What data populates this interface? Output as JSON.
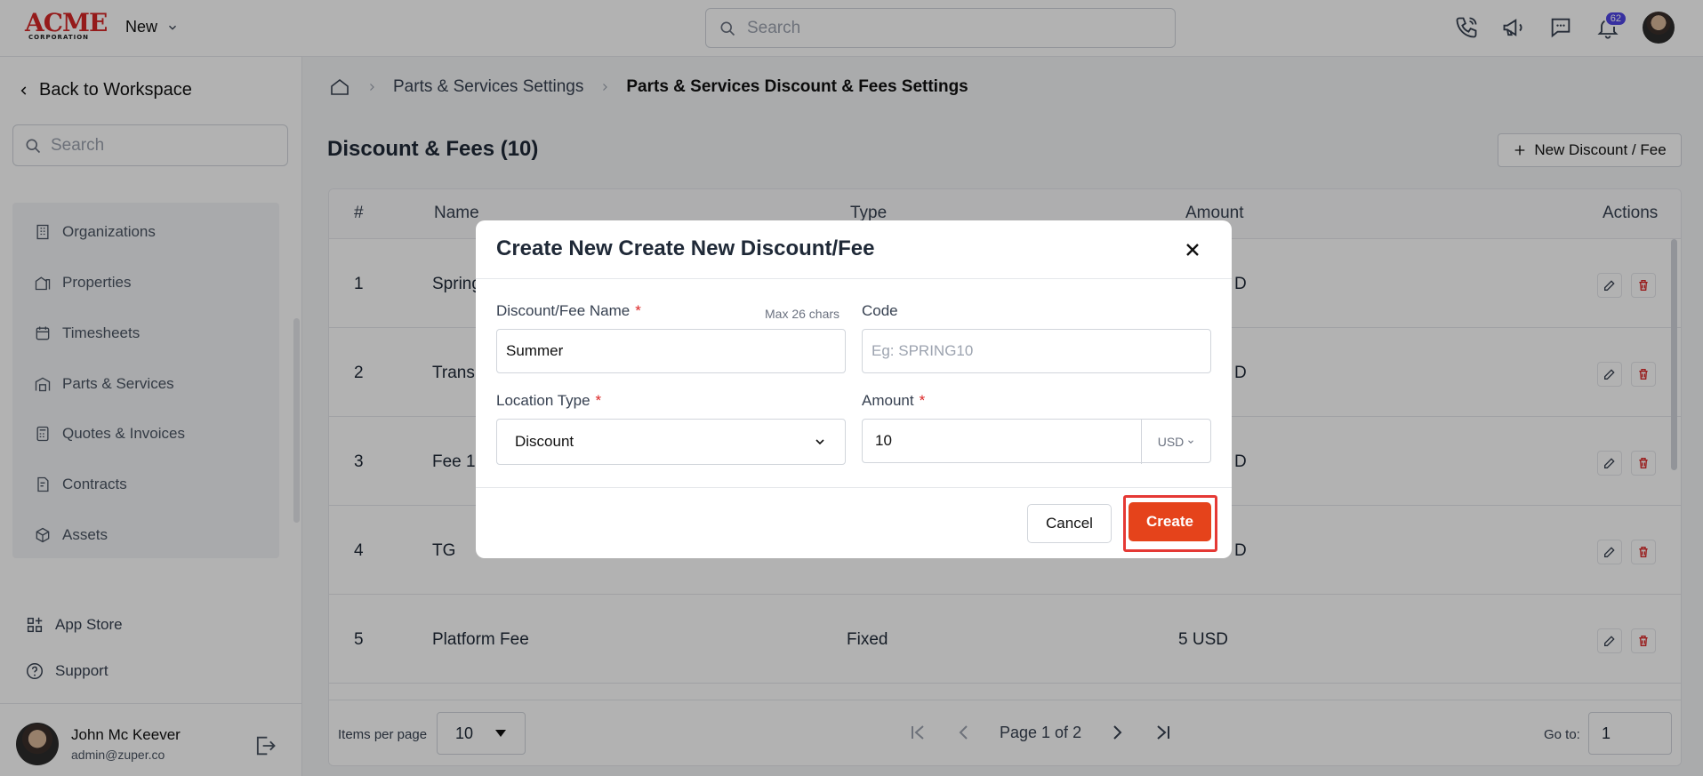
{
  "topbar": {
    "logo_text": "ACME",
    "logo_subtext": "CORPORATION",
    "new_label": "New",
    "search_placeholder": "Search",
    "notification_count": "62"
  },
  "sidebar": {
    "back_label": "Back to Workspace",
    "search_placeholder": "Search",
    "items": [
      {
        "label": "Organizations",
        "icon": "building-icon"
      },
      {
        "label": "Properties",
        "icon": "home-building-icon"
      },
      {
        "label": "Timesheets",
        "icon": "calendar-icon"
      },
      {
        "label": "Parts & Services",
        "icon": "warehouse-icon"
      },
      {
        "label": "Quotes & Invoices",
        "icon": "calculator-icon"
      },
      {
        "label": "Contracts",
        "icon": "contract-icon"
      },
      {
        "label": "Assets",
        "icon": "cube-icon"
      }
    ],
    "app_store_label": "App Store",
    "support_label": "Support",
    "user_name": "John Mc Keever",
    "user_email": "admin@zuper.co"
  },
  "breadcrumb": {
    "items": [
      "Parts & Services Settings",
      "Parts & Services Discount & Fees Settings"
    ]
  },
  "page": {
    "title": "Discount & Fees (10)",
    "new_button_label": "New Discount / Fee"
  },
  "table": {
    "headers": [
      "#",
      "Name",
      "Type",
      "Amount",
      "Actions"
    ],
    "rows": [
      {
        "num": "1",
        "name": "Spring",
        "type": "",
        "amount": "D"
      },
      {
        "num": "2",
        "name": "Trans",
        "type": "",
        "amount": "D"
      },
      {
        "num": "3",
        "name": "Fee 1",
        "type": "",
        "amount": "D"
      },
      {
        "num": "4",
        "name": "TG",
        "type": "",
        "amount": "D"
      },
      {
        "num": "5",
        "name": "Platform Fee",
        "type": "Fixed",
        "amount": "5 USD"
      }
    ]
  },
  "pagination": {
    "items_per_page_label": "Items per page",
    "items_per_page": "10",
    "page_text": "Page 1 of 2",
    "goto_label": "Go to:",
    "goto_value": "1"
  },
  "modal": {
    "title": "Create New Create New Discount/Fee",
    "name_label": "Discount/Fee Name",
    "name_hint": "Max 26 chars",
    "name_value": "Summer",
    "code_label": "Code",
    "code_placeholder": "Eg: SPRING10",
    "location_label": "Location Type",
    "location_value": "Discount",
    "amount_label": "Amount",
    "amount_value": "10",
    "currency": "USD",
    "required_mark": "*",
    "cancel_label": "Cancel",
    "create_label": "Create"
  },
  "colors": {
    "accent": "#e5431b",
    "highlight": "#e53935",
    "badge": "#4f46e5"
  }
}
